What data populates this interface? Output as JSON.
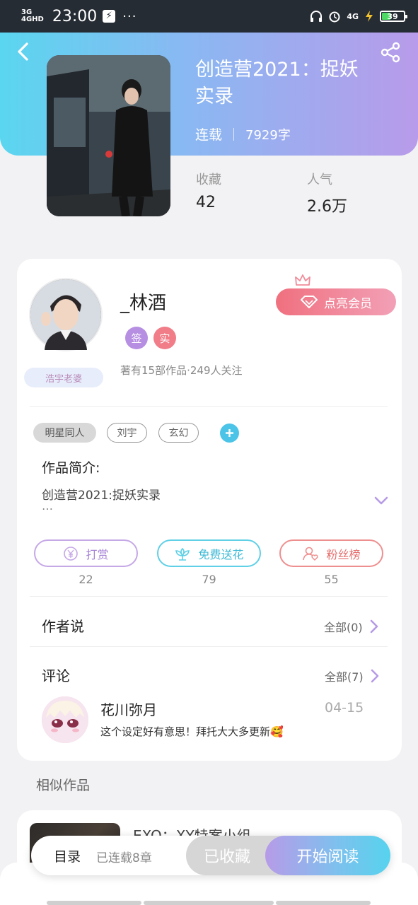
{
  "status_bar": {
    "net_top": "3G",
    "net_bottom": "4GHD",
    "time": "23:00",
    "flash_glyph": "⚡",
    "dots": "···",
    "net_right": "4G",
    "battery": "39",
    "battery_level": 0.39,
    "icons": [
      "headphones-icon",
      "alarm-icon",
      "charging-icon"
    ]
  },
  "book": {
    "title": "创造营2021：捉妖实录",
    "status": "连载",
    "word_count": "7929字",
    "stats": [
      {
        "label": "收藏",
        "value": "42"
      },
      {
        "label": "人气",
        "value": "2.6万"
      }
    ]
  },
  "author": {
    "name": "_林酒",
    "badge": "浩宇老婆",
    "tag_sign": "签",
    "tag_real": "实",
    "info": "著有15部作品·249人关注",
    "vip_label": "点亮会员"
  },
  "tags": [
    "明星同人",
    "刘宇",
    "玄幻"
  ],
  "intro": {
    "label": "作品简介:",
    "text": "创造营2021:捉妖实录",
    "ellipsis": "…"
  },
  "actions": [
    {
      "label": "打赏",
      "count": "22",
      "icon": "yuan-coin-icon"
    },
    {
      "label": "免费送花",
      "count": "79",
      "icon": "flower-icon"
    },
    {
      "label": "粉丝榜",
      "count": "55",
      "icon": "fan-heart-icon"
    }
  ],
  "author_says": {
    "title": "作者说",
    "more": "全部(0)"
  },
  "comments": {
    "title": "评论",
    "more": "全部(7)",
    "items": [
      {
        "user": "花川弥月",
        "date": "04-15",
        "text": "这个设定好有意思！拜托大大多更新🥰"
      }
    ]
  },
  "similar": {
    "title": "相似作品",
    "items": [
      {
        "name": "EXO：XY特案小组"
      }
    ]
  },
  "bottom": {
    "toc": "目录",
    "chapters": "已连载8章",
    "collected": "已收藏",
    "read": "开始阅读"
  },
  "colors": {
    "header_gradient_start": "#5ad6f0",
    "header_gradient_end": "#b89bea",
    "accent_purple": "#b68ee2",
    "accent_pink": "#f07d88",
    "accent_cyan": "#4cc4e8"
  }
}
